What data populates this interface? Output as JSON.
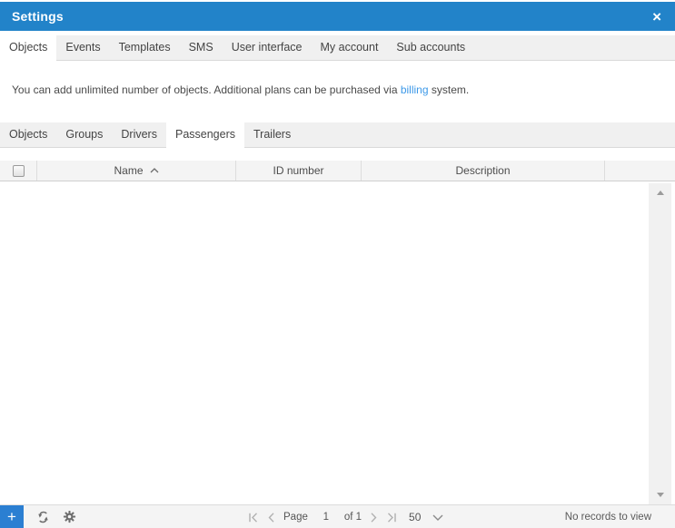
{
  "colors": {
    "header_blue": "#2283c9",
    "add_button_blue": "#2b7fd2",
    "link_blue": "#3d99e8"
  },
  "titlebar": {
    "title": "Settings",
    "close_icon": "×"
  },
  "tabs": {
    "items": [
      "Objects",
      "Events",
      "Templates",
      "SMS",
      "User interface",
      "My account",
      "Sub accounts"
    ],
    "active": "Objects"
  },
  "info": {
    "text_before": "You can add unlimited number of objects. Additional plans can be purchased via ",
    "link_text": "billing",
    "text_after": " system."
  },
  "subtabs": {
    "items": [
      "Objects",
      "Groups",
      "Drivers",
      "Passengers",
      "Trailers"
    ],
    "active": "Passengers"
  },
  "grid": {
    "header_checkbox_checked": false,
    "columns": [
      {
        "label": "Name",
        "sorted": "asc"
      },
      {
        "label": "ID number",
        "sorted": null
      },
      {
        "label": "Description",
        "sorted": null
      }
    ],
    "rows": []
  },
  "footer": {
    "add_icon": "+",
    "pager": {
      "page_label": "Page",
      "current_page": "1",
      "of_label": "of 1",
      "page_size": "50"
    },
    "status": "No records to view"
  }
}
